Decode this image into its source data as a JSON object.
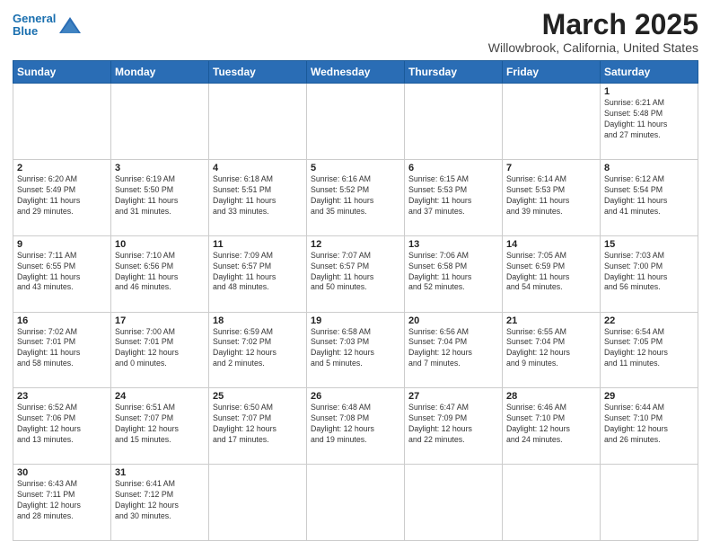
{
  "header": {
    "logo_line1": "General",
    "logo_line2": "Blue",
    "title": "March 2025",
    "subtitle": "Willowbrook, California, United States"
  },
  "days_of_week": [
    "Sunday",
    "Monday",
    "Tuesday",
    "Wednesday",
    "Thursday",
    "Friday",
    "Saturday"
  ],
  "weeks": [
    [
      {
        "day": "",
        "info": ""
      },
      {
        "day": "",
        "info": ""
      },
      {
        "day": "",
        "info": ""
      },
      {
        "day": "",
        "info": ""
      },
      {
        "day": "",
        "info": ""
      },
      {
        "day": "",
        "info": ""
      },
      {
        "day": "1",
        "info": "Sunrise: 6:21 AM\nSunset: 5:48 PM\nDaylight: 11 hours\nand 27 minutes."
      }
    ],
    [
      {
        "day": "2",
        "info": "Sunrise: 6:20 AM\nSunset: 5:49 PM\nDaylight: 11 hours\nand 29 minutes."
      },
      {
        "day": "3",
        "info": "Sunrise: 6:19 AM\nSunset: 5:50 PM\nDaylight: 11 hours\nand 31 minutes."
      },
      {
        "day": "4",
        "info": "Sunrise: 6:18 AM\nSunset: 5:51 PM\nDaylight: 11 hours\nand 33 minutes."
      },
      {
        "day": "5",
        "info": "Sunrise: 6:16 AM\nSunset: 5:52 PM\nDaylight: 11 hours\nand 35 minutes."
      },
      {
        "day": "6",
        "info": "Sunrise: 6:15 AM\nSunset: 5:53 PM\nDaylight: 11 hours\nand 37 minutes."
      },
      {
        "day": "7",
        "info": "Sunrise: 6:14 AM\nSunset: 5:53 PM\nDaylight: 11 hours\nand 39 minutes."
      },
      {
        "day": "8",
        "info": "Sunrise: 6:12 AM\nSunset: 5:54 PM\nDaylight: 11 hours\nand 41 minutes."
      }
    ],
    [
      {
        "day": "9",
        "info": "Sunrise: 7:11 AM\nSunset: 6:55 PM\nDaylight: 11 hours\nand 43 minutes."
      },
      {
        "day": "10",
        "info": "Sunrise: 7:10 AM\nSunset: 6:56 PM\nDaylight: 11 hours\nand 46 minutes."
      },
      {
        "day": "11",
        "info": "Sunrise: 7:09 AM\nSunset: 6:57 PM\nDaylight: 11 hours\nand 48 minutes."
      },
      {
        "day": "12",
        "info": "Sunrise: 7:07 AM\nSunset: 6:57 PM\nDaylight: 11 hours\nand 50 minutes."
      },
      {
        "day": "13",
        "info": "Sunrise: 7:06 AM\nSunset: 6:58 PM\nDaylight: 11 hours\nand 52 minutes."
      },
      {
        "day": "14",
        "info": "Sunrise: 7:05 AM\nSunset: 6:59 PM\nDaylight: 11 hours\nand 54 minutes."
      },
      {
        "day": "15",
        "info": "Sunrise: 7:03 AM\nSunset: 7:00 PM\nDaylight: 11 hours\nand 56 minutes."
      }
    ],
    [
      {
        "day": "16",
        "info": "Sunrise: 7:02 AM\nSunset: 7:01 PM\nDaylight: 11 hours\nand 58 minutes."
      },
      {
        "day": "17",
        "info": "Sunrise: 7:00 AM\nSunset: 7:01 PM\nDaylight: 12 hours\nand 0 minutes."
      },
      {
        "day": "18",
        "info": "Sunrise: 6:59 AM\nSunset: 7:02 PM\nDaylight: 12 hours\nand 2 minutes."
      },
      {
        "day": "19",
        "info": "Sunrise: 6:58 AM\nSunset: 7:03 PM\nDaylight: 12 hours\nand 5 minutes."
      },
      {
        "day": "20",
        "info": "Sunrise: 6:56 AM\nSunset: 7:04 PM\nDaylight: 12 hours\nand 7 minutes."
      },
      {
        "day": "21",
        "info": "Sunrise: 6:55 AM\nSunset: 7:04 PM\nDaylight: 12 hours\nand 9 minutes."
      },
      {
        "day": "22",
        "info": "Sunrise: 6:54 AM\nSunset: 7:05 PM\nDaylight: 12 hours\nand 11 minutes."
      }
    ],
    [
      {
        "day": "23",
        "info": "Sunrise: 6:52 AM\nSunset: 7:06 PM\nDaylight: 12 hours\nand 13 minutes."
      },
      {
        "day": "24",
        "info": "Sunrise: 6:51 AM\nSunset: 7:07 PM\nDaylight: 12 hours\nand 15 minutes."
      },
      {
        "day": "25",
        "info": "Sunrise: 6:50 AM\nSunset: 7:07 PM\nDaylight: 12 hours\nand 17 minutes."
      },
      {
        "day": "26",
        "info": "Sunrise: 6:48 AM\nSunset: 7:08 PM\nDaylight: 12 hours\nand 19 minutes."
      },
      {
        "day": "27",
        "info": "Sunrise: 6:47 AM\nSunset: 7:09 PM\nDaylight: 12 hours\nand 22 minutes."
      },
      {
        "day": "28",
        "info": "Sunrise: 6:46 AM\nSunset: 7:10 PM\nDaylight: 12 hours\nand 24 minutes."
      },
      {
        "day": "29",
        "info": "Sunrise: 6:44 AM\nSunset: 7:10 PM\nDaylight: 12 hours\nand 26 minutes."
      }
    ],
    [
      {
        "day": "30",
        "info": "Sunrise: 6:43 AM\nSunset: 7:11 PM\nDaylight: 12 hours\nand 28 minutes."
      },
      {
        "day": "31",
        "info": "Sunrise: 6:41 AM\nSunset: 7:12 PM\nDaylight: 12 hours\nand 30 minutes."
      },
      {
        "day": "",
        "info": ""
      },
      {
        "day": "",
        "info": ""
      },
      {
        "day": "",
        "info": ""
      },
      {
        "day": "",
        "info": ""
      },
      {
        "day": "",
        "info": ""
      }
    ]
  ]
}
